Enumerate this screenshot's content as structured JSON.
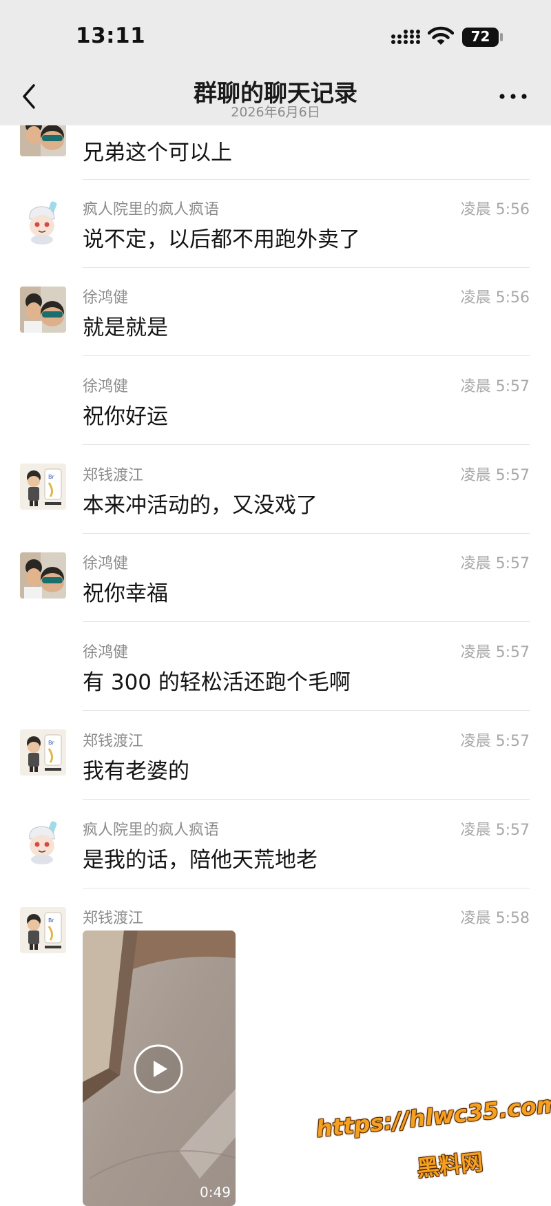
{
  "status_bar": {
    "time": "13:11",
    "battery_level": "72",
    "signal_icon": "cellular-signal-icon",
    "wifi_icon": "wifi-icon",
    "battery_icon": "battery-icon"
  },
  "header": {
    "title": "群聊的聊天记录",
    "date": "2026年6月6日",
    "back_icon": "chevron-left-icon",
    "more_icon": "more-dots-icon"
  },
  "messages": [
    {
      "sender": "",
      "time": "",
      "text": "兄弟这个可以上"
    },
    {
      "sender": "疯人院里的疯人疯语",
      "time": "凌晨 5:56",
      "text": "说不定，以后都不用跑外卖了"
    },
    {
      "sender": "徐鸿健",
      "time": "凌晨 5:56",
      "text": "就是就是"
    },
    {
      "sender": "徐鸿健",
      "time": "凌晨 5:57",
      "text": "祝你好运"
    },
    {
      "sender": "郑钱渡江",
      "time": "凌晨 5:57",
      "text": "本来冲活动的，又没戏了"
    },
    {
      "sender": "徐鸿健",
      "time": "凌晨 5:57",
      "text": "祝你幸福"
    },
    {
      "sender": "徐鸿健",
      "time": "凌晨 5:57",
      "text": "有 300 的轻松活还跑个毛啊"
    },
    {
      "sender": "郑钱渡江",
      "time": "凌晨 5:57",
      "text": "我有老婆的"
    },
    {
      "sender": "疯人院里的疯人疯语",
      "time": "凌晨 5:57",
      "text": "是我的话，陪他天荒地老"
    },
    {
      "sender": "郑钱渡江",
      "time": "凌晨 5:58",
      "text": ""
    }
  ],
  "video": {
    "duration": "0:49",
    "play_icon": "play-icon"
  },
  "watermark": {
    "url": "https://hlwc35.com",
    "name": "黑料网"
  },
  "colors": {
    "header_bg": "#ebebeb",
    "watermark": "#f5a020"
  }
}
